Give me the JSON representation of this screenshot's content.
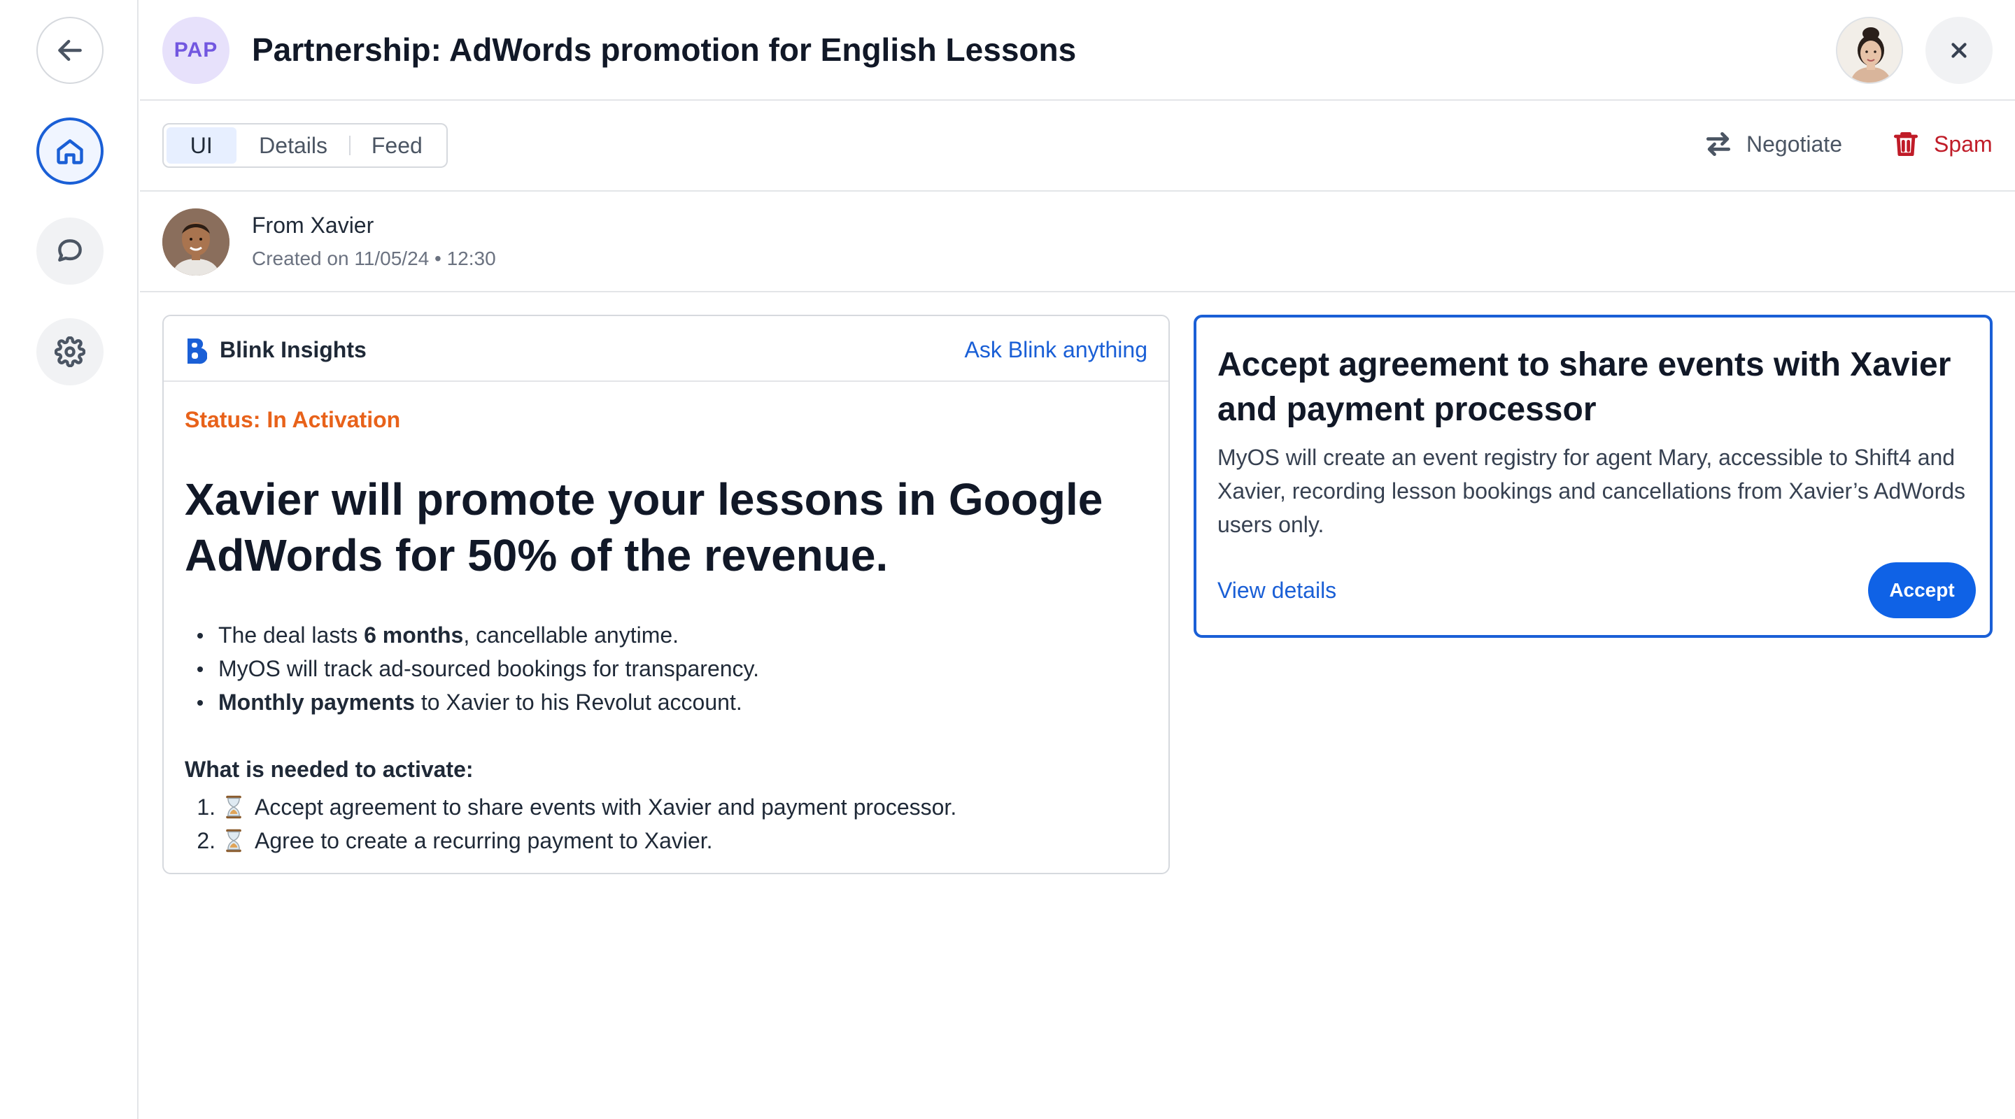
{
  "header": {
    "badge": "PAP",
    "title": "Partnership: AdWords promotion for English Lessons",
    "avatar_icon": "user-avatar",
    "close_icon": "close-icon"
  },
  "nav": {
    "items": [
      {
        "name": "back",
        "icon": "arrow-left-icon"
      },
      {
        "name": "home",
        "icon": "home-icon",
        "active": true
      },
      {
        "name": "chat",
        "icon": "chat-bubble-icon"
      },
      {
        "name": "settings",
        "icon": "gear-icon"
      }
    ]
  },
  "tabs": {
    "items": [
      "UI",
      "Details",
      "Feed"
    ],
    "active": "UI"
  },
  "actions": {
    "negotiate": "Negotiate",
    "spam": "Spam"
  },
  "from": {
    "name": "From Xavier",
    "meta": "Created on 11/05/24 • 12:30"
  },
  "insights": {
    "title": "Blink Insights",
    "ask_link": "Ask Blink anything",
    "status": "Status: In Activation",
    "headline": "Xavier will promote your lessons in Google AdWords for 50% of the revenue.",
    "bullets": [
      {
        "pre": "The deal lasts ",
        "bold": "6 months",
        "post": ", cancellable anytime."
      },
      {
        "pre": "MyOS will track ad-sourced bookings for transparency.",
        "bold": "",
        "post": ""
      },
      {
        "pre": "",
        "bold": "Monthly payments",
        "post": " to Xavier to his Revolut account."
      }
    ],
    "needed_title": "What is needed to activate:",
    "steps": [
      {
        "num": "1.",
        "text": "Accept agreement to share events with Xavier and payment processor."
      },
      {
        "num": "2.",
        "text": "Agree to create a recurring payment to Xavier."
      }
    ]
  },
  "accept_card": {
    "title": "Accept agreement to share events with Xavier and payment processor",
    "description": "MyOS will create an event registry for agent Mary, accessible to Shift4 and Xavier, recording lesson bookings and cancellations from Xavier’s AdWords users only.",
    "view_link": "View details",
    "accept_button": "Accept"
  },
  "colors": {
    "accent": "#1a5fd6",
    "status": "#e8621a",
    "danger": "#c01c28",
    "badge_bg": "#e7e1fb"
  }
}
